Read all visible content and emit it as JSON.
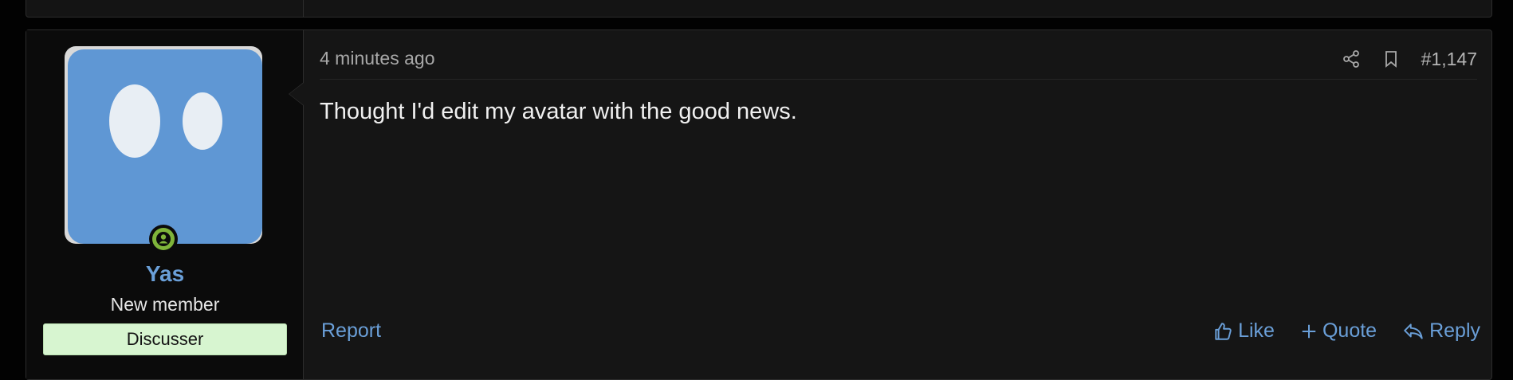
{
  "post": {
    "time": "4 minutes ago",
    "number": "#1,147",
    "message": "Thought I'd edit my avatar with the good news."
  },
  "user": {
    "name": "Yas",
    "title": "New member",
    "banner": "Discusser"
  },
  "icons": {
    "share": "share-icon",
    "bookmark": "bookmark-icon",
    "like": "thumbs-up-icon",
    "quote": "plus-icon",
    "reply": "reply-arrow-icon",
    "online": "online-status-icon"
  },
  "actions": {
    "report": "Report",
    "like": "Like",
    "quote": "Quote",
    "reply": "Reply"
  },
  "colors": {
    "accent": "#6a9fd8",
    "online": "#7fb43a",
    "banner_bg": "#d7f5d0"
  }
}
